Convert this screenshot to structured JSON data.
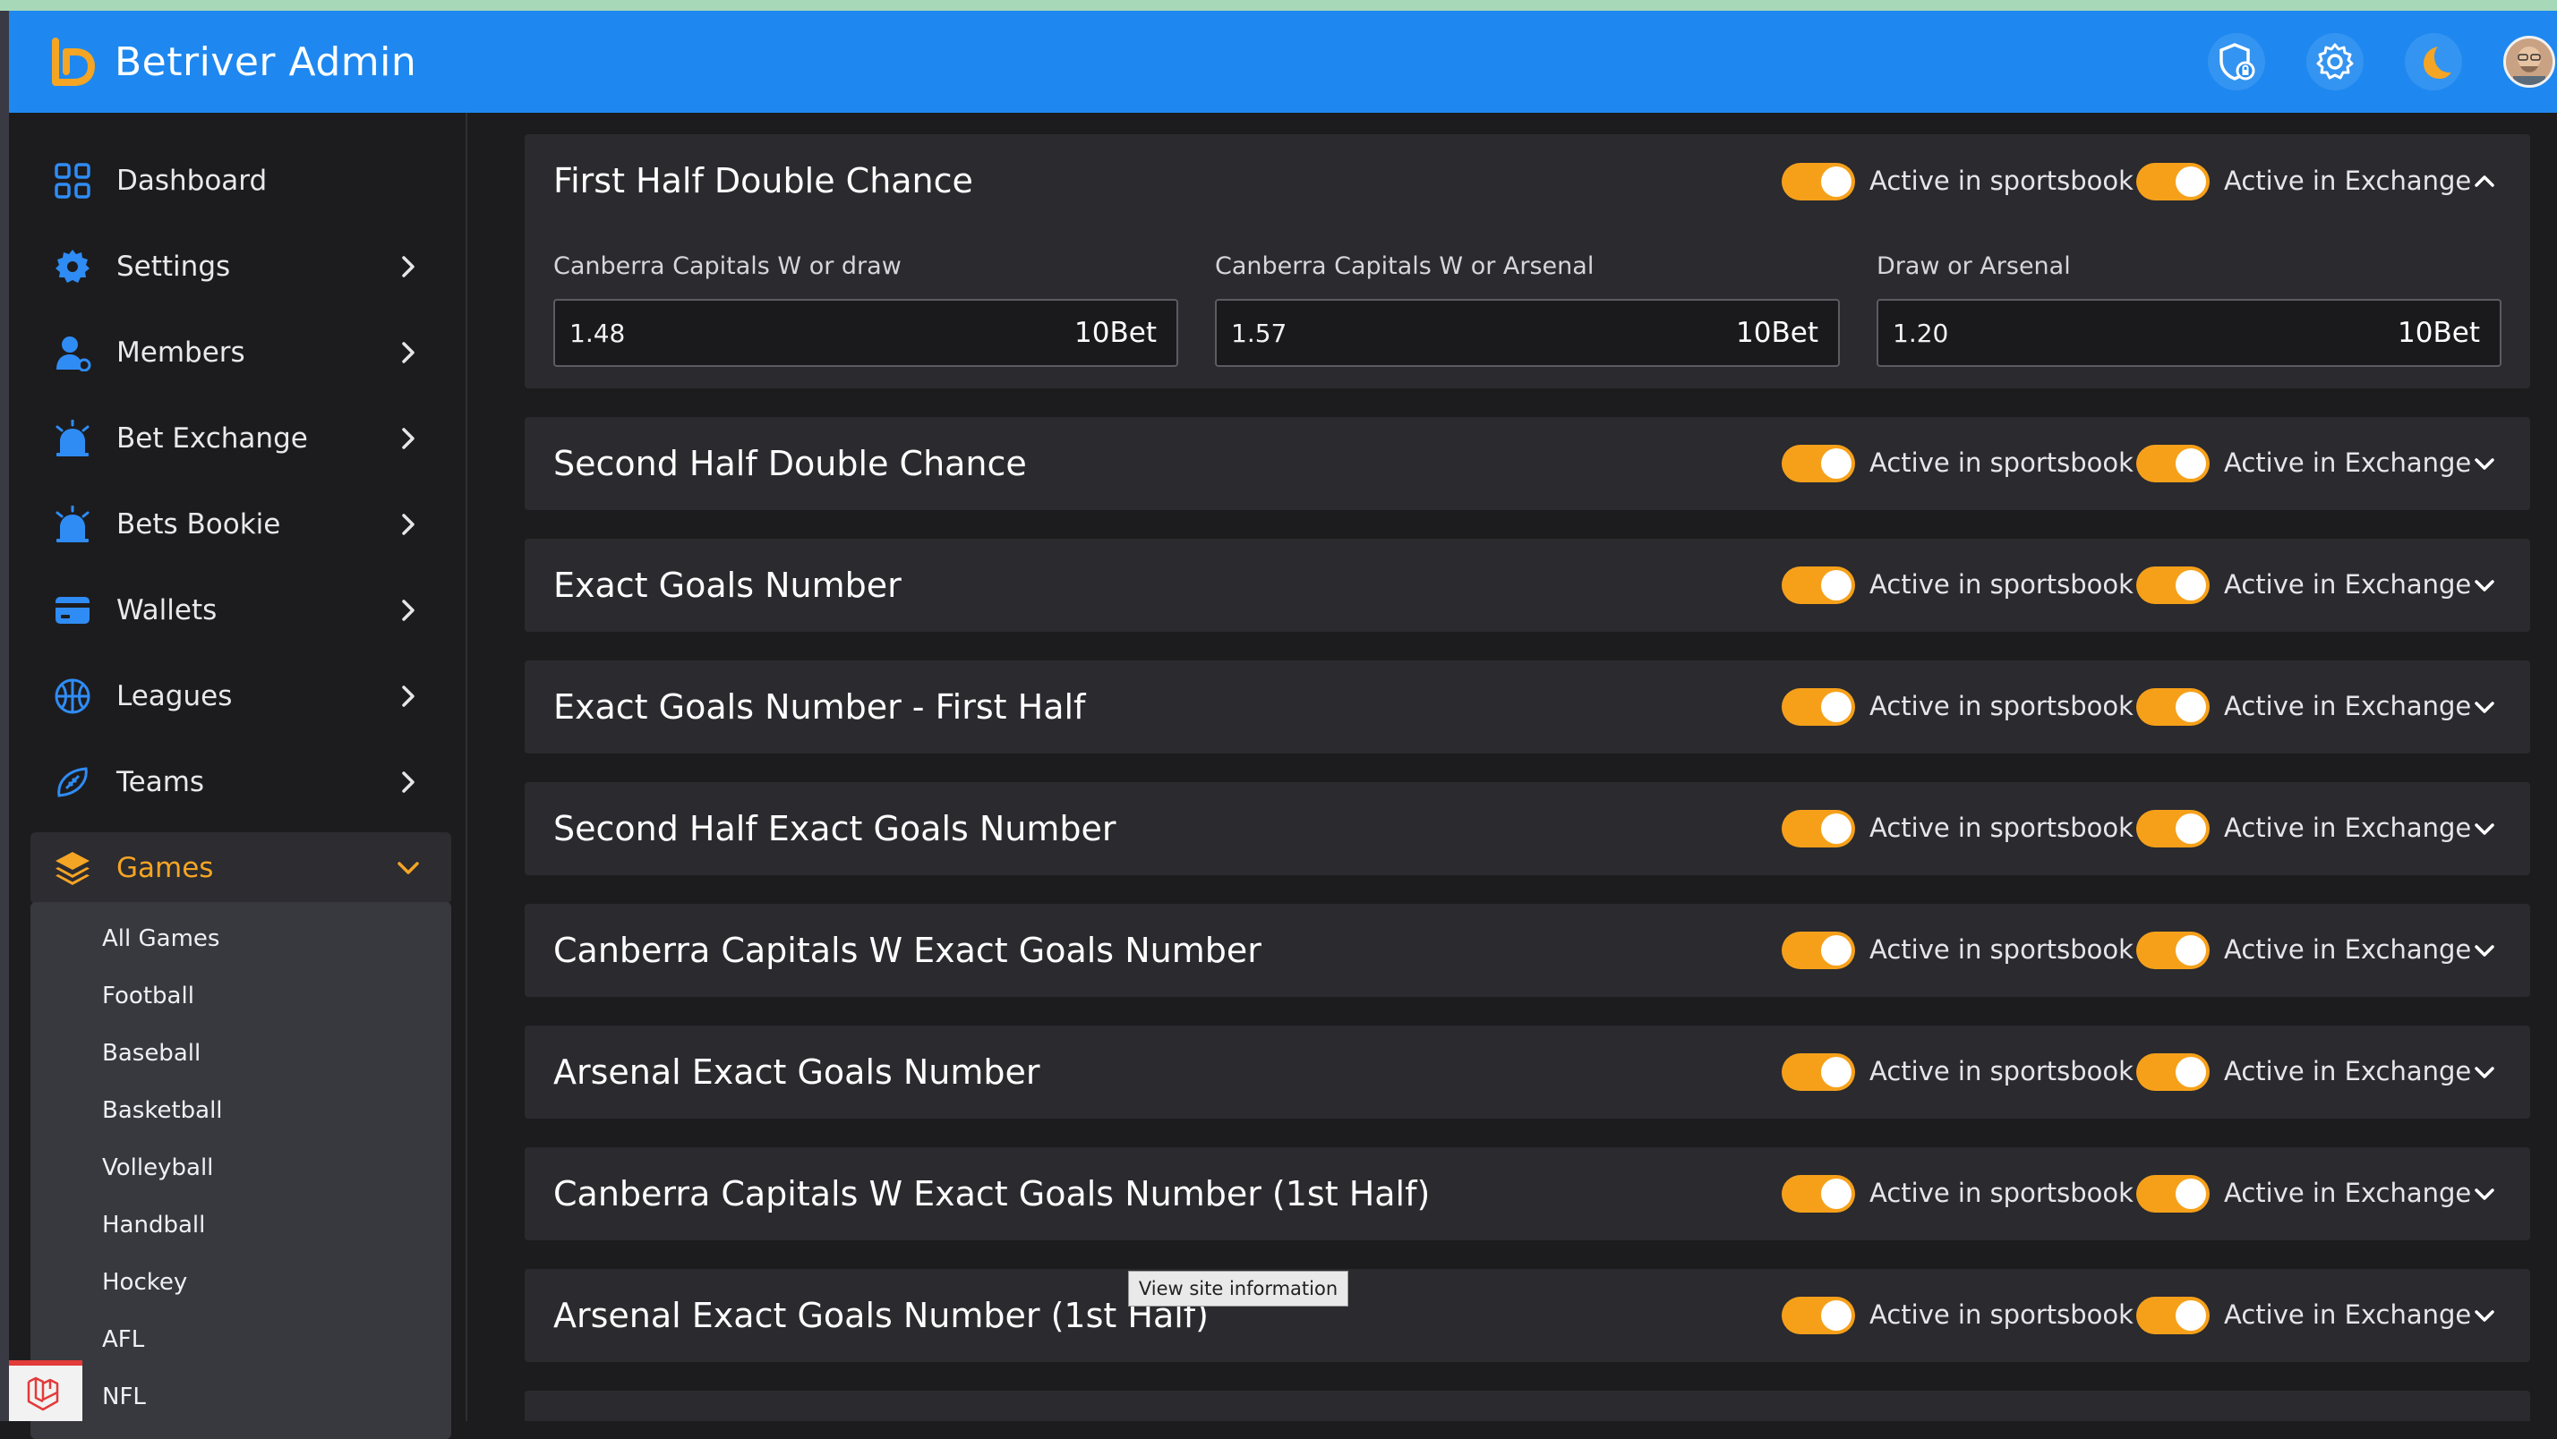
{
  "app": {
    "title": "Betriver Admin"
  },
  "header": {
    "icons": [
      "shield-lock-icon",
      "gear-icon",
      "moon-icon",
      "user-avatar"
    ]
  },
  "sidebar": {
    "items": [
      {
        "label": "Dashboard",
        "icon": "dashboard-grid-icon",
        "has_chevron": false
      },
      {
        "label": "Settings",
        "icon": "gear-icon",
        "has_chevron": true
      },
      {
        "label": "Members",
        "icon": "member-icon",
        "has_chevron": true
      },
      {
        "label": "Bet Exchange",
        "icon": "alarm-icon",
        "has_chevron": true
      },
      {
        "label": "Bets Bookie",
        "icon": "alarm-icon",
        "has_chevron": true
      },
      {
        "label": "Wallets",
        "icon": "wallet-icon",
        "has_chevron": true
      },
      {
        "label": "Leagues",
        "icon": "basketball-icon",
        "has_chevron": true
      },
      {
        "label": "Teams",
        "icon": "football-icon",
        "has_chevron": true
      },
      {
        "label": "Games",
        "icon": "layers-icon",
        "has_chevron": true,
        "active": true
      }
    ],
    "games_submenu": [
      "All Games",
      "Football",
      "Baseball",
      "Basketball",
      "Volleyball",
      "Handball",
      "Hockey",
      "AFL",
      "NFL"
    ]
  },
  "toggles": {
    "sportsbook_label": "Active in sportsbook",
    "exchange_label": "Active in Exchange"
  },
  "markets": [
    {
      "title": "First Half Double Chance",
      "expanded": true,
      "outcomes": [
        {
          "label": "Canberra Capitals W or draw",
          "odds": "1.48",
          "bookmaker": "10Bet"
        },
        {
          "label": "Canberra Capitals W or Arsenal",
          "odds": "1.57",
          "bookmaker": "10Bet"
        },
        {
          "label": "Draw or Arsenal",
          "odds": "1.20",
          "bookmaker": "10Bet"
        }
      ]
    },
    {
      "title": "Second Half Double Chance",
      "expanded": false
    },
    {
      "title": "Exact Goals Number",
      "expanded": false
    },
    {
      "title": "Exact Goals Number - First Half",
      "expanded": false
    },
    {
      "title": "Second Half Exact Goals Number",
      "expanded": false
    },
    {
      "title": "Canberra Capitals W Exact Goals Number",
      "expanded": false
    },
    {
      "title": "Arsenal Exact Goals Number",
      "expanded": false
    },
    {
      "title": "Canberra Capitals W Exact Goals Number (1st Half)",
      "expanded": false
    },
    {
      "title": "Arsenal Exact Goals Number (1st Half)",
      "expanded": false
    }
  ],
  "tooltip": {
    "text": "View site information"
  },
  "colors": {
    "header_blue": "#1e88f0",
    "accent_orange": "#f5a524",
    "toggle_orange": "#f6a01a",
    "panel_bg": "#2a2a2f",
    "page_bg": "#1c1c1e"
  }
}
